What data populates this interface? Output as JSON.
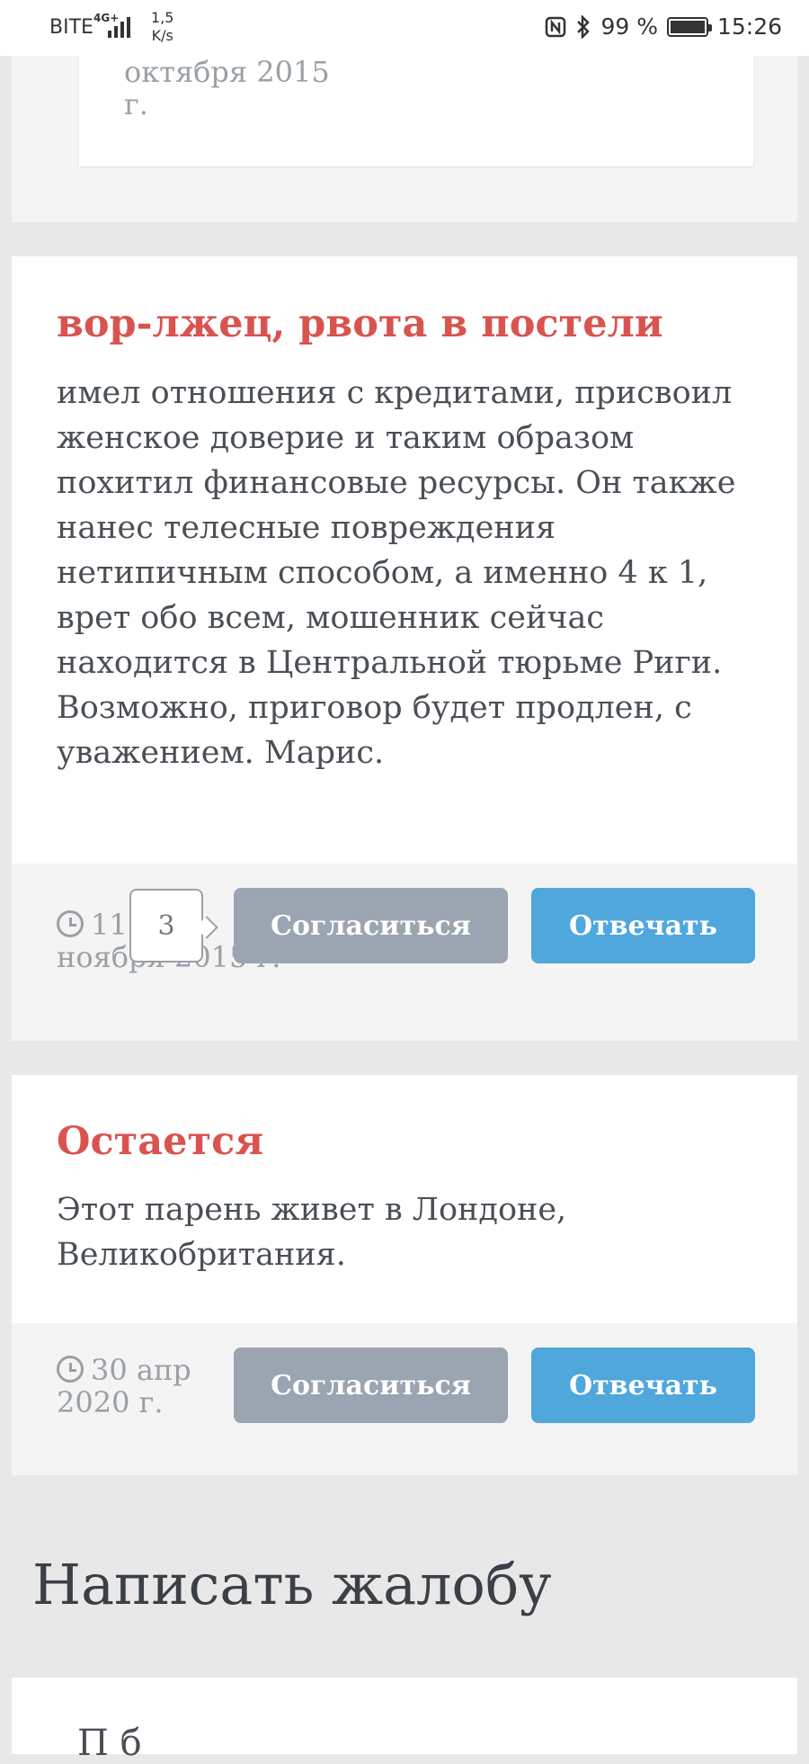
{
  "status_bar": {
    "carrier": "BITE",
    "network": "4G+",
    "speed_value": "1,5",
    "speed_unit": "K/s",
    "nfc_icon": "nfc-icon",
    "bluetooth_icon": "bluetooth-icon",
    "battery": "99 %",
    "battery_level": 0.99,
    "time": "15:26"
  },
  "top_card": {
    "date_line1": "октября 2015",
    "date_line2": "г."
  },
  "complaint1": {
    "title": "вор-лжец, рвота в постели",
    "body": "имел отношения с кредитами, присвоил женское доверие и таким образом похитил финансовые ресурсы. Он также нанес телесные повреждения нетипичным способом, а именно 4 к 1, врет обо всем, мошенник сейчас находится в Центральной тюрьме Риги. Возможно, приговор будет продлен, с уважением. Марис.",
    "date_line1": "11",
    "date_line2": "ноября 2015 г.",
    "agree_count": "3",
    "agree_label": "Согласиться",
    "reply_label": "Отвечать"
  },
  "complaint2": {
    "title": "Остается",
    "body": "Этот парень живет в Лондоне, Великобритания.",
    "date_line1": "30 апр",
    "date_line2": "2020 г.",
    "agree_label": "Согласиться",
    "reply_label": "Отвечать"
  },
  "write_section": {
    "title": "Написать жалобу",
    "form_hint_partial": "П                б"
  },
  "colors": {
    "title_red": "#d9534f",
    "button_gray": "#9aa5b1",
    "button_blue": "#4fa7dc",
    "page_bg": "#e8e8e8"
  }
}
